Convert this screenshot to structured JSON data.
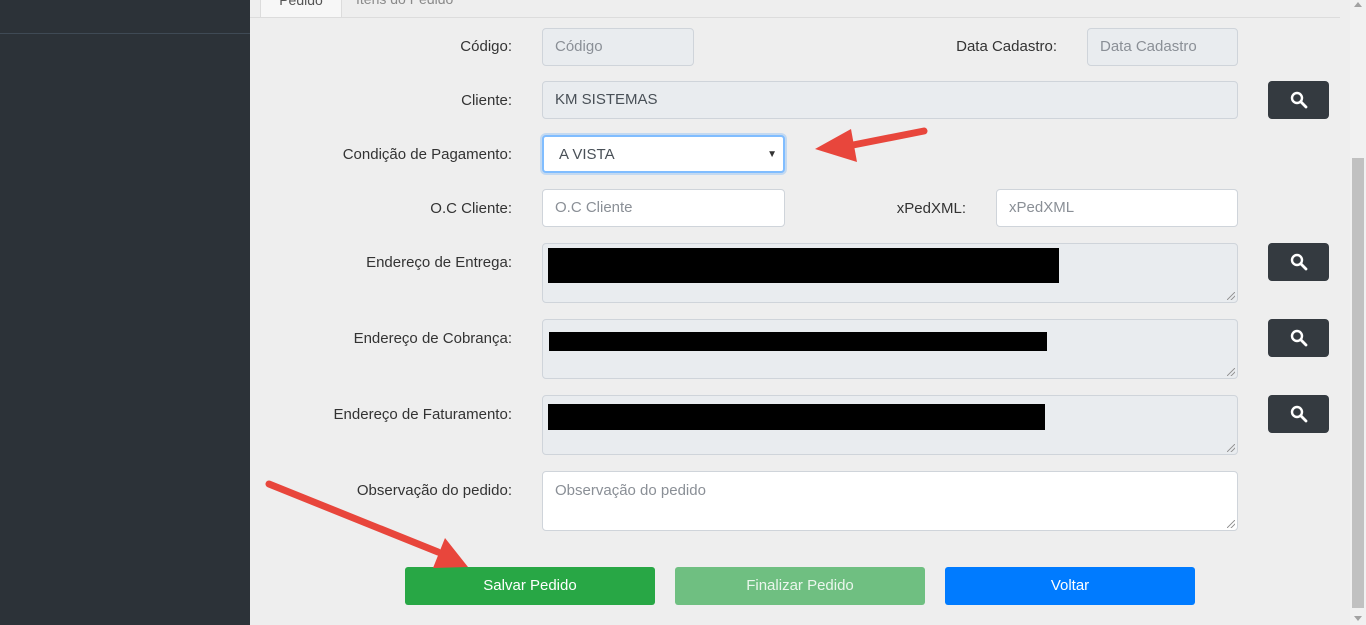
{
  "tabs": {
    "active_label": "Pedido",
    "other_label": "Itens do Pedido"
  },
  "form": {
    "codigo": {
      "label": "Código:",
      "placeholder": "Código"
    },
    "data_cadastro": {
      "label": "Data Cadastro:",
      "placeholder": "Data Cadastro"
    },
    "cliente": {
      "label": "Cliente:",
      "value": "KM SISTEMAS"
    },
    "condicao_pagamento": {
      "label": "Condição de Pagamento:",
      "selected": "A VISTA"
    },
    "oc_cliente": {
      "label": "O.C Cliente:",
      "placeholder": "O.C Cliente"
    },
    "xpedxml": {
      "label": "xPedXML:",
      "placeholder": "xPedXML"
    },
    "endereco_entrega": {
      "label": "Endereço de Entrega:"
    },
    "endereco_cobranca": {
      "label": "Endereço de Cobrança:"
    },
    "endereco_faturamento": {
      "label": "Endereço de Faturamento:"
    },
    "observacao": {
      "label": "Observação do pedido:",
      "placeholder": "Observação do pedido"
    }
  },
  "buttons": {
    "save": "Salvar Pedido",
    "finish": "Finalizar Pedido",
    "back": "Voltar"
  },
  "icons": {
    "search": "search-icon",
    "caret": "caret-down-icon"
  },
  "colors": {
    "sidebar": "#2c3238",
    "save": "#28a745",
    "finish": "#6fbf81",
    "back": "#007bff",
    "search_button": "#343a40",
    "annotation_arrow": "#e8463c"
  }
}
